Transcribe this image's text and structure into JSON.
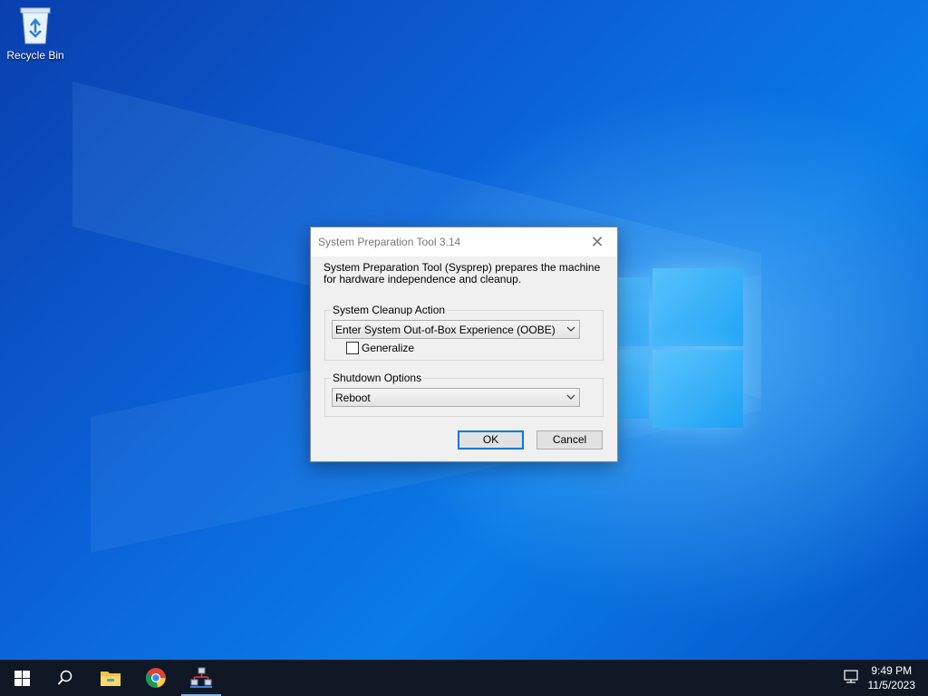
{
  "desktop": {
    "icons": [
      {
        "label": "Recycle Bin",
        "icon": "recycle-bin-icon"
      }
    ]
  },
  "dialog": {
    "title": "System Preparation Tool 3.14",
    "close_label": "✕",
    "description": "System Preparation Tool (Sysprep) prepares the machine for hardware independence and cleanup.",
    "cleanup_group": {
      "legend": "System Cleanup Action",
      "selected": "Enter System Out-of-Box Experience (OOBE)",
      "generalize_label": "Generalize",
      "generalize_checked": false
    },
    "shutdown_group": {
      "legend": "Shutdown Options",
      "selected": "Reboot"
    },
    "ok_label": "OK",
    "cancel_label": "Cancel"
  },
  "taskbar": {
    "items": [
      "start-icon",
      "search-icon",
      "file-explorer-icon",
      "chrome-icon",
      "network-app-icon"
    ],
    "active_item": "network-app-icon",
    "clock": {
      "time": "9:49 PM",
      "date": "11/5/2023"
    }
  },
  "colors": {
    "accent": "#0078d7",
    "taskbar": "#101826"
  }
}
